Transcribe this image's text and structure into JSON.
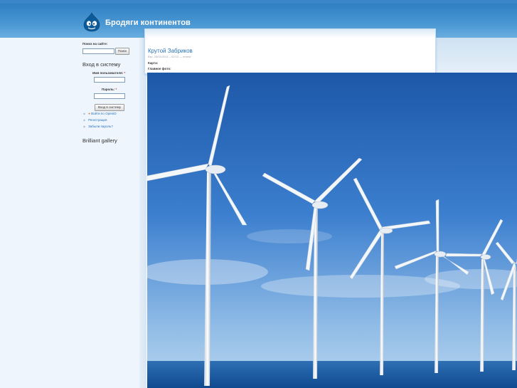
{
  "site": {
    "name": "Бродяги континентов"
  },
  "search": {
    "label": "Поиск на сайте:",
    "value": "",
    "button": "Поиск"
  },
  "login": {
    "title": "Вход в систему",
    "username_label": "Имя пользователя:",
    "password_label": "Пароль:",
    "required_mark": "*",
    "username_value": "",
    "password_value": "",
    "submit": "Вход в систему",
    "links": [
      {
        "label": "Войти по OpenID",
        "icon": "openid-icon"
      },
      {
        "label": "Регистрация",
        "icon": "bullet-icon"
      },
      {
        "label": "Забыли пароль?",
        "icon": "bullet-icon"
      }
    ]
  },
  "gallery_block": {
    "title": "Brilliant gallery"
  },
  "node": {
    "title": "Крутой Забриков",
    "meta": "Втр, 25/01/2011 – 02:02 — ernest",
    "field_map_label": "Карта:",
    "field_photo_label": "Главное фото:"
  },
  "colors": {
    "header_blue": "#3b86c6",
    "link_blue": "#2a73b8",
    "sidebar_bg": "#eef5fc"
  }
}
